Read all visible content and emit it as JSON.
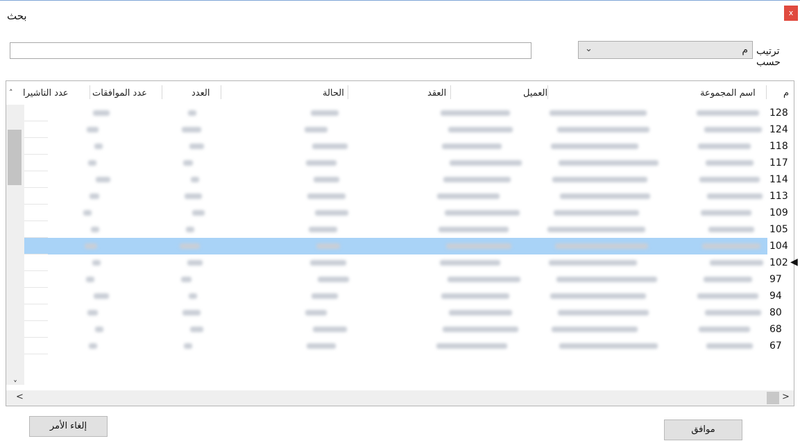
{
  "window": {
    "title": "بحث",
    "close_label": "x"
  },
  "sort": {
    "label": "ترتيب حسب",
    "selected": "م"
  },
  "search": {
    "value": "",
    "placeholder": ""
  },
  "table": {
    "headers": {
      "m": "م",
      "group": "اسم المجموعة",
      "client": "العميل",
      "contract": "العقد",
      "status": "الحالة",
      "count": "العدد",
      "approvals": "عدد الموافقات",
      "visas": "عدد التاشيرا"
    },
    "rows": [
      {
        "m": "128"
      },
      {
        "m": "124"
      },
      {
        "m": "118"
      },
      {
        "m": "117"
      },
      {
        "m": "114"
      },
      {
        "m": "113"
      },
      {
        "m": "109"
      },
      {
        "m": "105"
      },
      {
        "m": "104"
      },
      {
        "m": "102"
      },
      {
        "m": "97"
      },
      {
        "m": "94"
      },
      {
        "m": "80"
      },
      {
        "m": "68"
      },
      {
        "m": "67"
      }
    ],
    "selected_index": 8
  },
  "buttons": {
    "ok": "موافق",
    "cancel": "إلغاء الأمر"
  },
  "colors": {
    "selection": "#a9d3f7",
    "close": "#e04a3f"
  }
}
